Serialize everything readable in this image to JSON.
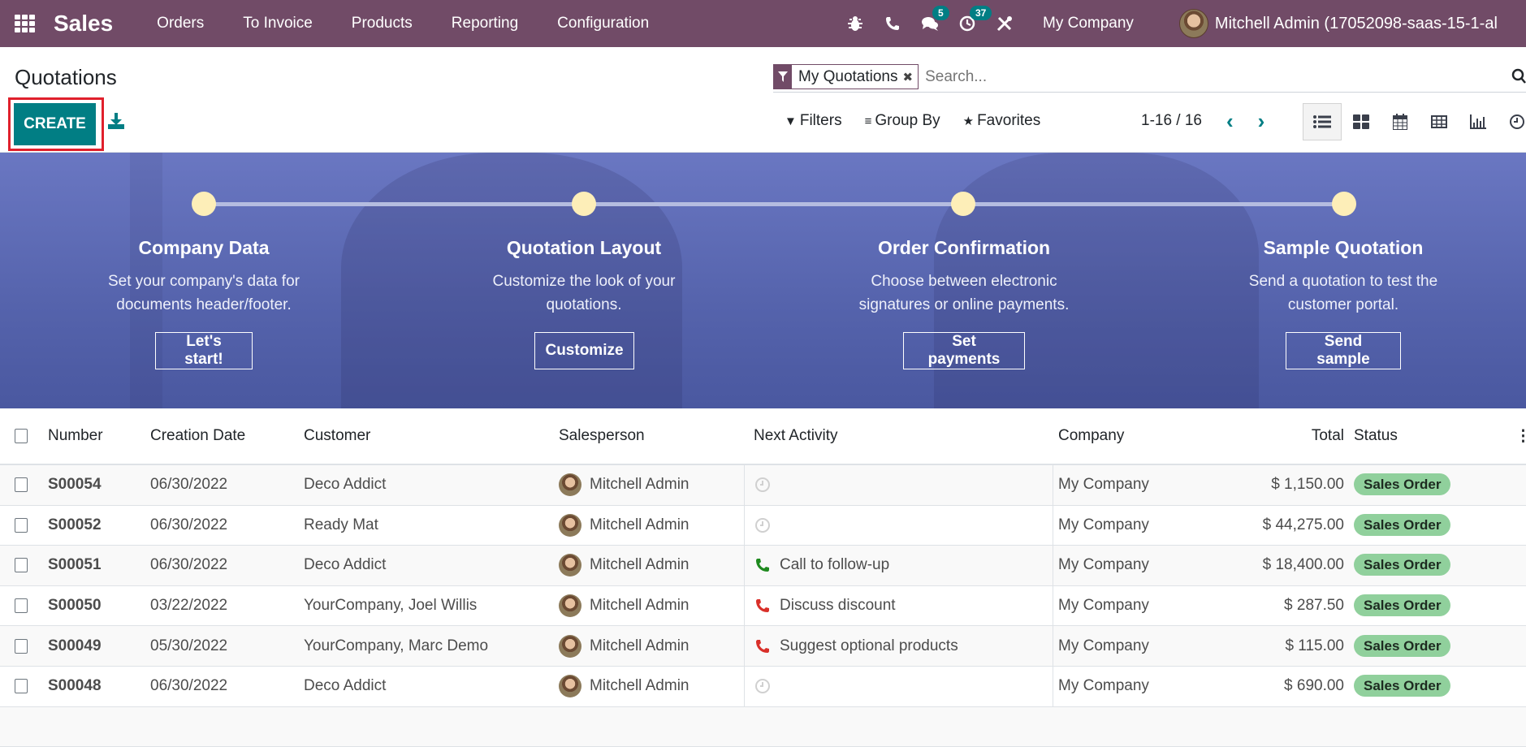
{
  "navbar": {
    "app_name": "Sales",
    "menu": [
      "Orders",
      "To Invoice",
      "Products",
      "Reporting",
      "Configuration"
    ],
    "icons": [
      {
        "name": "bug-icon",
        "badge": null
      },
      {
        "name": "phone-icon",
        "badge": null
      },
      {
        "name": "chat-icon",
        "badge": "5"
      },
      {
        "name": "activity-clock-icon",
        "badge": "37"
      },
      {
        "name": "tools-icon",
        "badge": null
      }
    ],
    "company": "My Company",
    "user": "Mitchell Admin (17052098-saas-15-1-al"
  },
  "control_panel": {
    "title": "Quotations",
    "create_label": "CREATE",
    "search": {
      "facet": "My Quotations",
      "placeholder": "Search..."
    },
    "filters_label": "Filters",
    "group_by_label": "Group By",
    "favorites_label": "Favorites",
    "pager": "1-16 / 16",
    "views": [
      "list",
      "kanban",
      "calendar",
      "pivot",
      "graph",
      "activity"
    ],
    "active_view": "list"
  },
  "banner": {
    "steps": [
      {
        "title": "Company Data",
        "desc1": "Set your company's data for",
        "desc2": "documents header/footer.",
        "button": "Let's start!"
      },
      {
        "title": "Quotation Layout",
        "desc1": "Customize the look of your",
        "desc2": "quotations.",
        "button": "Customize"
      },
      {
        "title": "Order Confirmation",
        "desc1": "Choose between electronic",
        "desc2": "signatures or online payments.",
        "button": "Set payments"
      },
      {
        "title": "Sample Quotation",
        "desc1": "Send a quotation to test the",
        "desc2": "customer portal.",
        "button": "Send sample"
      }
    ]
  },
  "table": {
    "headers": {
      "number": "Number",
      "date": "Creation Date",
      "customer": "Customer",
      "salesperson": "Salesperson",
      "activity": "Next Activity",
      "company": "Company",
      "total": "Total",
      "status": "Status"
    },
    "rows": [
      {
        "number": "S00054",
        "date": "06/30/2022",
        "customer": "Deco Addict",
        "salesperson": "Mitchell Admin",
        "activity": "",
        "activity_type": "none",
        "company": "My Company",
        "total": "$ 1,150.00",
        "status": "Sales Order"
      },
      {
        "number": "S00052",
        "date": "06/30/2022",
        "customer": "Ready Mat",
        "salesperson": "Mitchell Admin",
        "activity": "",
        "activity_type": "none",
        "company": "My Company",
        "total": "$ 44,275.00",
        "status": "Sales Order"
      },
      {
        "number": "S00051",
        "date": "06/30/2022",
        "customer": "Deco Addict",
        "salesperson": "Mitchell Admin",
        "activity": "Call to follow-up",
        "activity_type": "planned",
        "company": "My Company",
        "total": "$ 18,400.00",
        "status": "Sales Order"
      },
      {
        "number": "S00050",
        "date": "03/22/2022",
        "customer": "YourCompany, Joel Willis",
        "salesperson": "Mitchell Admin",
        "activity": "Discuss discount",
        "activity_type": "overdue",
        "company": "My Company",
        "total": "$ 287.50",
        "status": "Sales Order"
      },
      {
        "number": "S00049",
        "date": "05/30/2022",
        "customer": "YourCompany, Marc Demo",
        "salesperson": "Mitchell Admin",
        "activity": "Suggest optional products",
        "activity_type": "overdue",
        "company": "My Company",
        "total": "$ 115.00",
        "status": "Sales Order"
      },
      {
        "number": "S00048",
        "date": "06/30/2022",
        "customer": "Deco Addict",
        "salesperson": "Mitchell Admin",
        "activity": "",
        "activity_type": "none",
        "company": "My Company",
        "total": "$ 690.00",
        "status": "Sales Order"
      }
    ]
  },
  "colors": {
    "brand": "#714B67",
    "accent": "#017E84",
    "status_pill": "#90D09C",
    "activity_planned": "#1F8A1F",
    "activity_overdue": "#D9302A",
    "highlight_border": "#E0202C"
  }
}
